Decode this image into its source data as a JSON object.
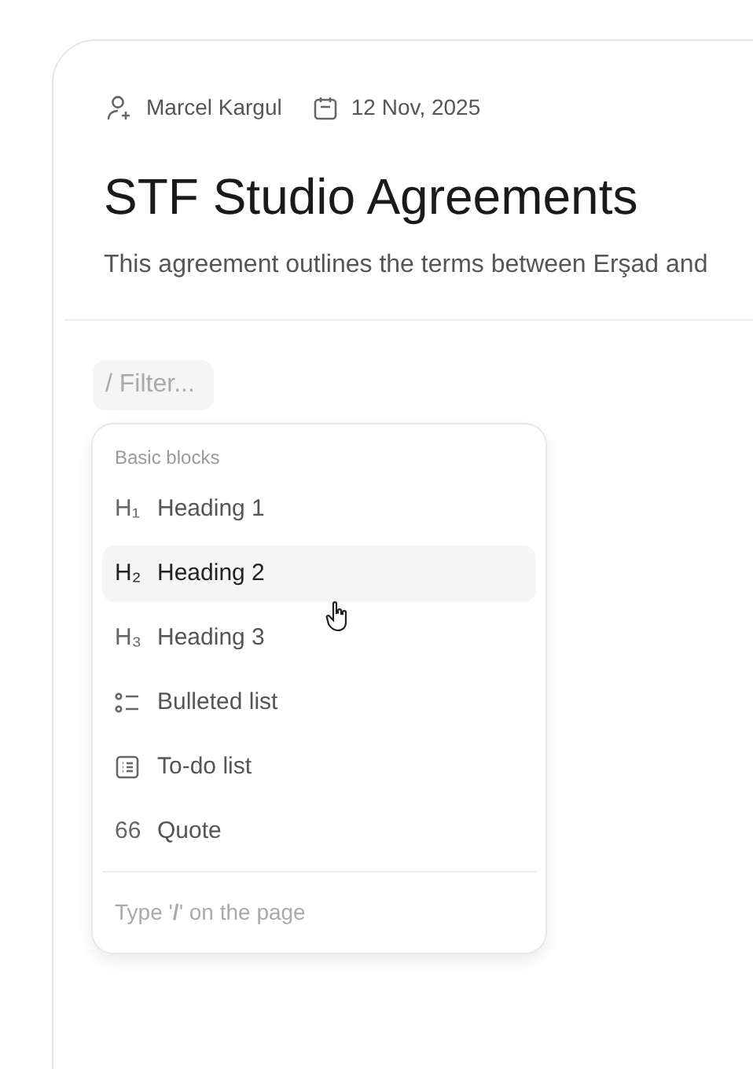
{
  "meta": {
    "author": "Marcel Kargul",
    "date": "12 Nov, 2025"
  },
  "title": "STF Studio Agreements",
  "description": "This agreement outlines the terms between Erşad and",
  "filter": {
    "placeholder": "/ Filter..."
  },
  "menu": {
    "section": "Basic blocks",
    "items": [
      {
        "kind": "glyph",
        "glyph": "H₁",
        "label": "Heading 1",
        "selected": false
      },
      {
        "kind": "glyph",
        "glyph": "H₂",
        "label": "Heading 2",
        "selected": true
      },
      {
        "kind": "glyph",
        "glyph": "H₃",
        "label": "Heading 3",
        "selected": false
      },
      {
        "kind": "bullets",
        "label": "Bulleted list",
        "selected": false
      },
      {
        "kind": "todo",
        "label": "To-do list",
        "selected": false
      },
      {
        "kind": "glyph",
        "glyph": "66",
        "label": "Quote",
        "selected": false
      }
    ],
    "footer": "Type '**/**' on the page"
  }
}
